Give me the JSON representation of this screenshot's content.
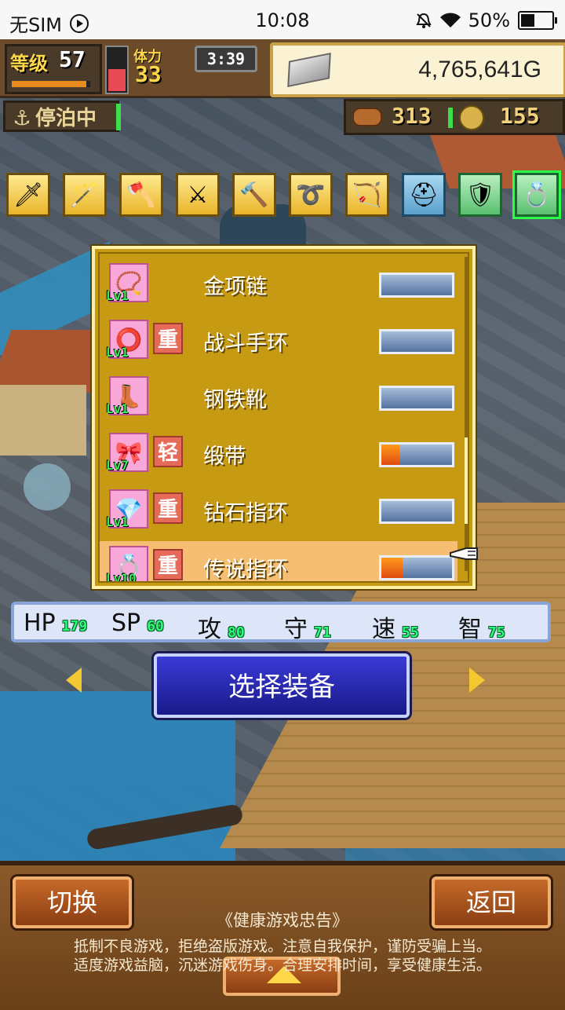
{
  "status_bar": {
    "carrier": "无SIM",
    "time": "10:08",
    "battery": "50%",
    "battery_level": 0.5
  },
  "hud": {
    "level_label": "等级",
    "level": "57",
    "exp_progress": 0.95,
    "hp_level": 0.55,
    "stamina_label": "体力",
    "stamina": "33",
    "timer": "3:39",
    "gold": "4,765,641G",
    "dock_label": "停泊中",
    "wood": "313",
    "coins": "155"
  },
  "categories": [
    {
      "name": "sword",
      "icon": "🗡",
      "type": "weapon"
    },
    {
      "name": "staff",
      "icon": "🪄",
      "type": "weapon"
    },
    {
      "name": "axe",
      "icon": "🪓",
      "type": "weapon"
    },
    {
      "name": "spear",
      "icon": "⚔",
      "type": "weapon"
    },
    {
      "name": "hammer",
      "icon": "🔨",
      "type": "weapon"
    },
    {
      "name": "whip",
      "icon": "➰",
      "type": "weapon"
    },
    {
      "name": "bow",
      "icon": "🏹",
      "type": "weapon"
    },
    {
      "name": "helmet",
      "icon": "⛑",
      "type": "armor"
    },
    {
      "name": "armor",
      "icon": "🛡",
      "type": "acc"
    },
    {
      "name": "accessory",
      "icon": "💍",
      "type": "acc",
      "selected": true
    }
  ],
  "items": [
    {
      "name": "金项链",
      "lv": "Lv1",
      "weight": "",
      "icon": "📿",
      "progress": 0.0,
      "selected": false
    },
    {
      "name": "战斗手环",
      "lv": "Lv1",
      "weight": "重",
      "icon": "⭕",
      "progress": 0.0,
      "selected": false
    },
    {
      "name": "钢铁靴",
      "lv": "Lv1",
      "weight": "",
      "icon": "👢",
      "progress": 0.0,
      "selected": false
    },
    {
      "name": "缎带",
      "lv": "Lv7",
      "weight": "轻",
      "icon": "🎀",
      "progress": 0.25,
      "selected": false
    },
    {
      "name": "钻石指环",
      "lv": "Lv1",
      "weight": "重",
      "icon": "💎",
      "progress": 0.0,
      "selected": false
    },
    {
      "name": "传说指环",
      "lv": "Lv10",
      "weight": "重",
      "icon": "💍",
      "progress": 0.3,
      "selected": true
    }
  ],
  "stats": [
    {
      "label": "HP",
      "value": "179"
    },
    {
      "label": "SP",
      "value": "60"
    },
    {
      "label": "攻",
      "value": "80"
    },
    {
      "label": "守",
      "value": "71"
    },
    {
      "label": "速",
      "value": "55"
    },
    {
      "label": "智",
      "value": "75"
    }
  ],
  "select_button": "选择装备",
  "bottom": {
    "switch_label": "切换",
    "back_label": "返回",
    "notice_title": "《健康游戏忠告》",
    "notice_line1": "抵制不良游戏，拒绝盗版游戏。注意自我保护，谨防受骗上当。",
    "notice_line2": "适度游戏益脑，沉迷游戏伤身。合理安排时间，享受健康生活。"
  },
  "colors": {
    "panel": "#c69a12",
    "selected_row": "#f5be72",
    "select_button": "#2a2ab0",
    "bottom_bar": "#7a4e22"
  }
}
